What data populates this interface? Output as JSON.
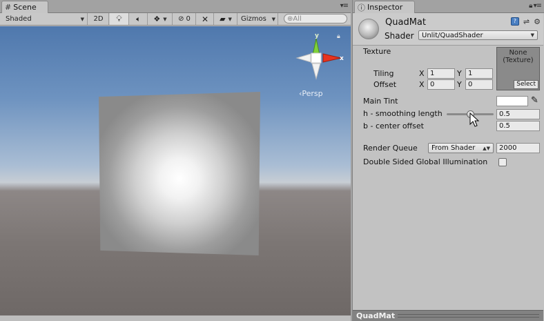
{
  "scene": {
    "tab_title": "Scene",
    "toolbar": {
      "shading_mode": "Shaded",
      "mode_2d": "2D",
      "effects_count": "0",
      "gizmos": "Gizmos",
      "search_placeholder": "⊕All"
    },
    "gizmo": {
      "y_label": "y",
      "x_label": "x"
    },
    "projection": "‹Persp"
  },
  "inspector": {
    "tab_title": "Inspector",
    "material_name": "QuadMat",
    "shader_label": "Shader",
    "shader_value": "Unlit/QuadShader",
    "texture": {
      "label": "Texture",
      "slot_text": "None\n(Texture)",
      "select_label": "Select",
      "tiling_label": "Tiling",
      "offset_label": "Offset",
      "x_label": "X",
      "y_label": "Y",
      "tiling_x": "1",
      "tiling_y": "1",
      "offset_x": "0",
      "offset_y": "0"
    },
    "main_tint_label": "Main Tint",
    "main_tint_color": "#ffffff",
    "smoothing_label": "h - smoothing length",
    "smoothing_value": "0.5",
    "smoothing_fraction": 0.5,
    "center_offset_label": "b - center offset",
    "center_offset_value": "0.5",
    "render_queue_label": "Render Queue",
    "render_queue_mode": "From Shader",
    "render_queue_value": "2000",
    "dsgi_label": "Double Sided Global Illumination",
    "dsgi_checked": false,
    "footer_name": "QuadMat"
  }
}
